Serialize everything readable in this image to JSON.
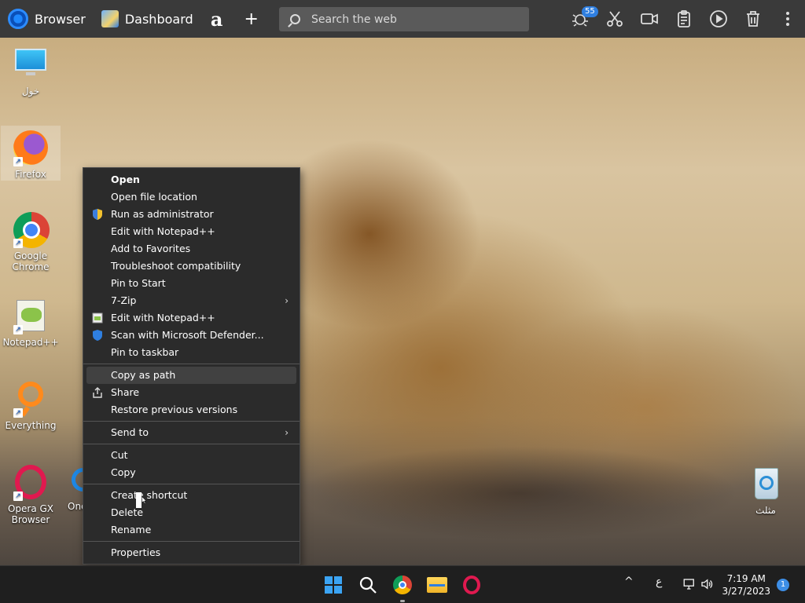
{
  "topbar": {
    "browser_label": "Browser",
    "dashboard_label": "Dashboard",
    "amazon_glyph": "a",
    "new_tab_glyph": "+",
    "search_placeholder": "Search the web",
    "badge_count": "55"
  },
  "desktop_icons": [
    {
      "label": "خول",
      "icon": "monitor-icon"
    },
    {
      "label": "Firefox",
      "icon": "firefox-icon"
    },
    {
      "label": "Google Chrome",
      "icon": "chrome-icon"
    },
    {
      "label": "Notepad++",
      "icon": "notepadpp-icon"
    },
    {
      "label": "Everything",
      "icon": "everything-icon"
    },
    {
      "label": "Opera GX Browser",
      "icon": "opera-gx-icon"
    },
    {
      "label": "One",
      "icon": "onedrive-icon"
    },
    {
      "label": "مثلث",
      "icon": "recycle-bin-icon"
    }
  ],
  "context_menu": {
    "groups": [
      [
        {
          "label": "Open",
          "bold": true
        },
        {
          "label": "Open file location"
        },
        {
          "label": "Run as administrator",
          "icon": "uac-shield-icon"
        },
        {
          "label": "Edit with Notepad++"
        },
        {
          "label": "Add to Favorites"
        },
        {
          "label": "Troubleshoot compatibility"
        },
        {
          "label": "Pin to Start"
        },
        {
          "label": "7-Zip",
          "submenu": true
        },
        {
          "label": "Edit with Notepad++",
          "icon": "notepadpp-small-icon"
        },
        {
          "label": "Scan with Microsoft Defender...",
          "icon": "defender-shield-icon"
        },
        {
          "label": "Pin to taskbar"
        }
      ],
      [
        {
          "label": "Copy as path",
          "hover": true
        },
        {
          "label": "Share",
          "icon": "share-icon"
        },
        {
          "label": "Restore previous versions"
        }
      ],
      [
        {
          "label": "Send to",
          "submenu": true
        }
      ],
      [
        {
          "label": "Cut"
        },
        {
          "label": "Copy"
        }
      ],
      [
        {
          "label": "Create shortcut"
        },
        {
          "label": "Delete"
        },
        {
          "label": "Rename"
        }
      ],
      [
        {
          "label": "Properties"
        }
      ]
    ],
    "submenu_glyph": "›"
  },
  "taskbar": {
    "tray_chevron": "^",
    "input_lang": "ع",
    "time": "7:19 AM",
    "date": "3/27/2023",
    "notification_count": "1"
  },
  "colors": {
    "topbar_bg": "#3a3a3a",
    "menu_bg": "#2b2b2b",
    "taskbar_bg": "#1f1f1f",
    "accent": "#2f7fe0"
  }
}
